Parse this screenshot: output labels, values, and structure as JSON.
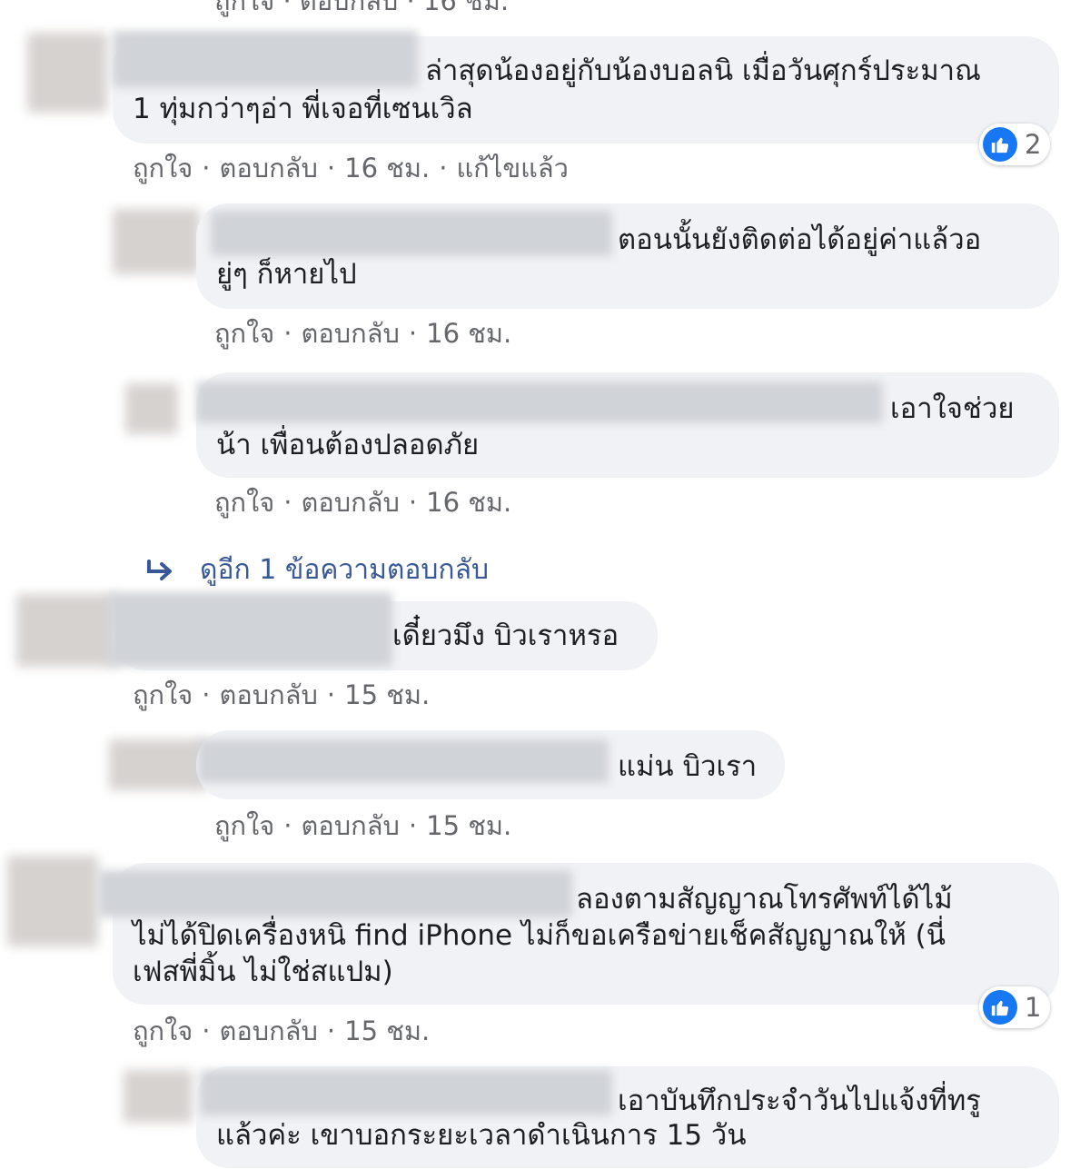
{
  "top_partial_actions": "ถูกใจ · ตอบกลับ · 16 ชม.",
  "more_replies_label": "ดูอีก 1 ข้อความตอบกลับ",
  "comments": [
    {
      "line1": "ล่าสุดน้องอยู่กับน้องบอลนิ เมื่อวันศุกร์ประมาณ",
      "line2": "1 ทุ่มกว่าๆอ่า พี่เจอที่เซนเวิล",
      "like": "ถูกใจ",
      "reply": "ตอบกลับ",
      "time": "16 ชม.",
      "edited": "แก้ไขแล้ว",
      "reaction_count": "2"
    },
    {
      "line1": "ตอนนั้นยังติดต่อได้อยู่ค่าแล้วอ",
      "line2": "ยู่ๆ ก็หายไป",
      "like": "ถูกใจ",
      "reply": "ตอบกลับ",
      "time": "16 ชม."
    },
    {
      "line1": "เอาใจช่วย",
      "line2": "น้า เพื่อนต้องปลอดภัย",
      "like": "ถูกใจ",
      "reply": "ตอบกลับ",
      "time": "16 ชม."
    },
    {
      "line1": "เดี๋ยวมึง บิวเราหรอ",
      "like": "ถูกใจ",
      "reply": "ตอบกลับ",
      "time": "15 ชม."
    },
    {
      "line1": "แม่น บิวเรา",
      "like": "ถูกใจ",
      "reply": "ตอบกลับ",
      "time": "15 ชม."
    },
    {
      "line1": "ลองตามสัญญาณโทรศัพท์ได้ไม้",
      "line2": "ไม่ได้ปิดเครื่องหนิ find iPhone ไม่ก็ขอเครือข่ายเช็คสัญญาณให้ (นี่",
      "line3": "เฟสพี่มิ้น ไม่ใช่สแปม)",
      "like": "ถูกใจ",
      "reply": "ตอบกลับ",
      "time": "15 ชม.",
      "reaction_count": "1"
    },
    {
      "line1": "เอาบันทึกประจำวันไปแจ้งที่ทรู",
      "line2": "แล้วค่ะ เขาบอกระยะเวลาดำเนินการ 15 วัน"
    }
  ]
}
